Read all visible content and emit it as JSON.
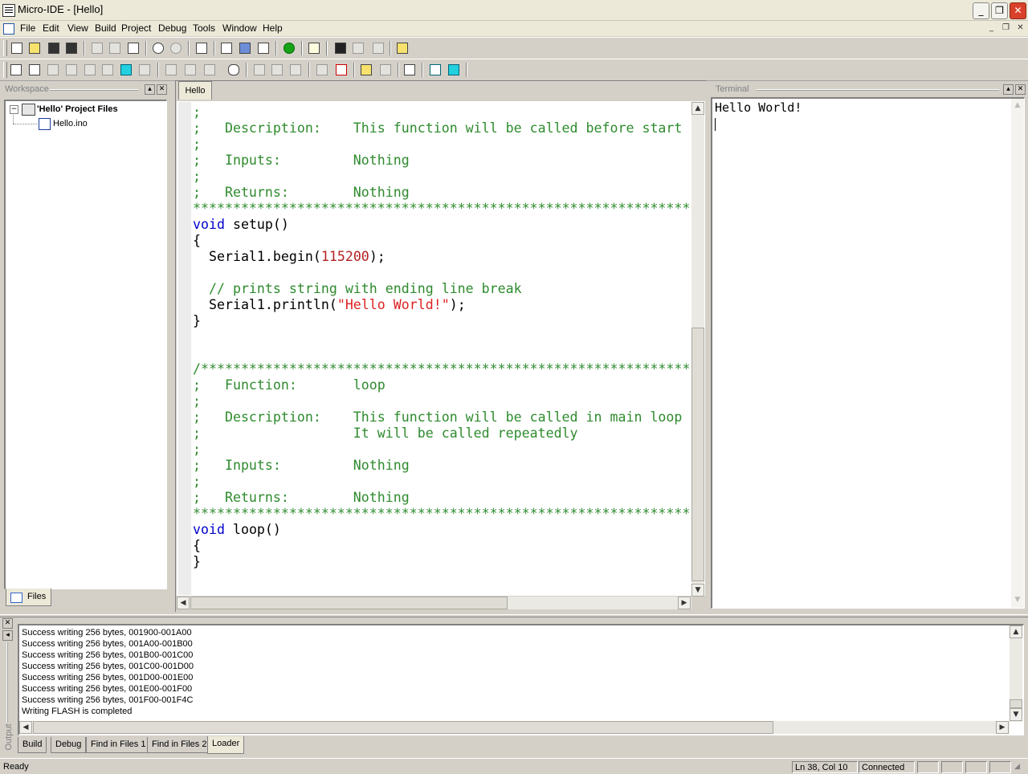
{
  "window": {
    "title": "Micro-IDE - [Hello]"
  },
  "menu": [
    "File",
    "Edit",
    "View",
    "Build",
    "Project",
    "Debug",
    "Tools",
    "Window",
    "Help"
  ],
  "toolbar_icons": {
    "row1": [
      "new-file-icon",
      "open-folder-icon",
      "save-icon",
      "save-all-icon",
      "cut-icon",
      "copy-icon",
      "paste-icon",
      "undo-icon",
      "redo-icon",
      "print-icon",
      "build-icon",
      "rebuild-icon",
      "compile-icon",
      "run-icon",
      "help-icon",
      "find-icon",
      "find-next-icon",
      "find-prev-icon",
      "find-in-files-icon"
    ],
    "row2": [
      "workspace-view-icon",
      "output-view-icon",
      "watch-icon",
      "registers-icon",
      "memory-icon",
      "call-stack-icon",
      "terminal-icon",
      "disassembly-icon",
      "step-into-icon",
      "step-over-icon",
      "step-out-icon",
      "halt-icon",
      "step-into-2-icon",
      "step-over-2-icon",
      "step-out-2-icon",
      "breakpoint-icon",
      "clear-breakpoints-icon",
      "connect-icon",
      "disconnect-icon",
      "properties-icon",
      "monitor-icon",
      "screen-icon"
    ]
  },
  "workspace": {
    "caption": "Workspace",
    "project": "'Hello' Project Files",
    "files": [
      "Hello.ino"
    ],
    "tab": "Files"
  },
  "editor": {
    "tab": "Hello",
    "lines": [
      [
        {
          "t": ";",
          "c": "cm"
        }
      ],
      [
        {
          "t": ";   Description:    This function will be called before start ",
          "c": "cm"
        }
      ],
      [
        {
          "t": ";",
          "c": "cm"
        }
      ],
      [
        {
          "t": ";   Inputs:         Nothing",
          "c": "cm"
        }
      ],
      [
        {
          "t": ";",
          "c": "cm"
        }
      ],
      [
        {
          "t": ";   Returns:        Nothing",
          "c": "cm"
        }
      ],
      [
        {
          "t": "**************************************************************",
          "c": "cm"
        }
      ],
      [
        {
          "t": "void",
          "c": "kw"
        },
        {
          "t": " setup()",
          "c": ""
        }
      ],
      [
        {
          "t": "{",
          "c": ""
        }
      ],
      [
        {
          "t": "  Serial1.begin(",
          "c": ""
        },
        {
          "t": "115200",
          "c": "num"
        },
        {
          "t": ");",
          "c": ""
        }
      ],
      [
        {
          "t": "",
          "c": ""
        }
      ],
      [
        {
          "t": "  // prints string with ending line break",
          "c": "cm"
        }
      ],
      [
        {
          "t": "  Serial1.println(",
          "c": ""
        },
        {
          "t": "\"Hello World!\"",
          "c": "str"
        },
        {
          "t": ");",
          "c": ""
        }
      ],
      [
        {
          "t": "}",
          "c": ""
        }
      ],
      [
        {
          "t": "",
          "c": ""
        }
      ],
      [
        {
          "t": "",
          "c": ""
        }
      ],
      [
        {
          "t": "/*************************************************************",
          "c": "cm"
        }
      ],
      [
        {
          "t": ";   Function:       loop",
          "c": "cm"
        }
      ],
      [
        {
          "t": ";",
          "c": "cm"
        }
      ],
      [
        {
          "t": ";   Description:    This function will be called in main loop",
          "c": "cm"
        }
      ],
      [
        {
          "t": ";                   It will be called repeatedly",
          "c": "cm"
        }
      ],
      [
        {
          "t": ";",
          "c": "cm"
        }
      ],
      [
        {
          "t": ";   Inputs:         Nothing",
          "c": "cm"
        }
      ],
      [
        {
          "t": ";",
          "c": "cm"
        }
      ],
      [
        {
          "t": ";   Returns:        Nothing",
          "c": "cm"
        }
      ],
      [
        {
          "t": "**************************************************************",
          "c": "cm"
        }
      ],
      [
        {
          "t": "void",
          "c": "kw"
        },
        {
          "t": " loop()",
          "c": ""
        }
      ],
      [
        {
          "t": "{",
          "c": ""
        }
      ],
      [
        {
          "t": "}",
          "c": ""
        }
      ]
    ]
  },
  "terminal": {
    "caption": "Terminal",
    "text": "Hello World!"
  },
  "output": {
    "caption": "Output",
    "lines": [
      "Success writing 256 bytes, 001900-001A00",
      "Success writing 256 bytes, 001A00-001B00",
      "Success writing 256 bytes, 001B00-001C00",
      "Success writing 256 bytes, 001C00-001D00",
      "Success writing 256 bytes, 001D00-001E00",
      "Success writing 256 bytes, 001E00-001F00",
      "Success writing 256 bytes, 001F00-001F4C",
      "Writing FLASH is completed"
    ],
    "tabs": [
      "Build",
      "Debug",
      "Find in Files 1",
      "Find in Files 2",
      "Loader"
    ],
    "active_tab": "Loader"
  },
  "status": {
    "text": "Ready",
    "position": "Ln 38, Col 10",
    "connection": "Connected"
  }
}
